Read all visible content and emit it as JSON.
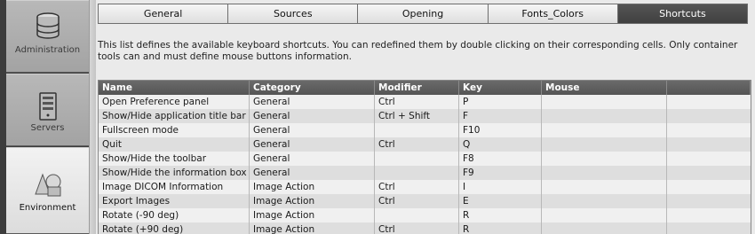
{
  "sidebar": {
    "items": [
      {
        "label": "Administration",
        "icon": "database-icon"
      },
      {
        "label": "Servers",
        "icon": "server-icon"
      },
      {
        "label": "Environment",
        "icon": "shapes-icon"
      }
    ]
  },
  "tabs": [
    "General",
    "Sources",
    "Opening",
    "Fonts_Colors",
    "Shortcuts"
  ],
  "active_tab": "Shortcuts",
  "description": "This list defines the available keyboard shortcuts. You can redefined them by double clicking on their corresponding cells. Only container tools can and must define mouse buttons information.",
  "table": {
    "columns": [
      "Name",
      "Category",
      "Modifier",
      "Key",
      "Mouse"
    ],
    "rows": [
      [
        "Open Preference panel",
        "General",
        "Ctrl",
        "P",
        ""
      ],
      [
        "Show/Hide application title bar",
        "General",
        "Ctrl + Shift",
        "F",
        ""
      ],
      [
        "Fullscreen mode",
        "General",
        "",
        "F10",
        ""
      ],
      [
        "Quit",
        "General",
        "Ctrl",
        "Q",
        ""
      ],
      [
        "Show/Hide the toolbar",
        "General",
        "",
        "F8",
        ""
      ],
      [
        "Show/Hide the information box",
        "General",
        "",
        "F9",
        ""
      ],
      [
        "Image DICOM Information",
        "Image Action",
        "Ctrl",
        "I",
        ""
      ],
      [
        "Export Images",
        "Image Action",
        "Ctrl",
        "E",
        ""
      ],
      [
        "Rotate (-90 deg)",
        "Image Action",
        "",
        "R",
        ""
      ],
      [
        "Rotate (+90 deg)",
        "Image Action",
        "Ctrl",
        "R",
        ""
      ]
    ]
  }
}
